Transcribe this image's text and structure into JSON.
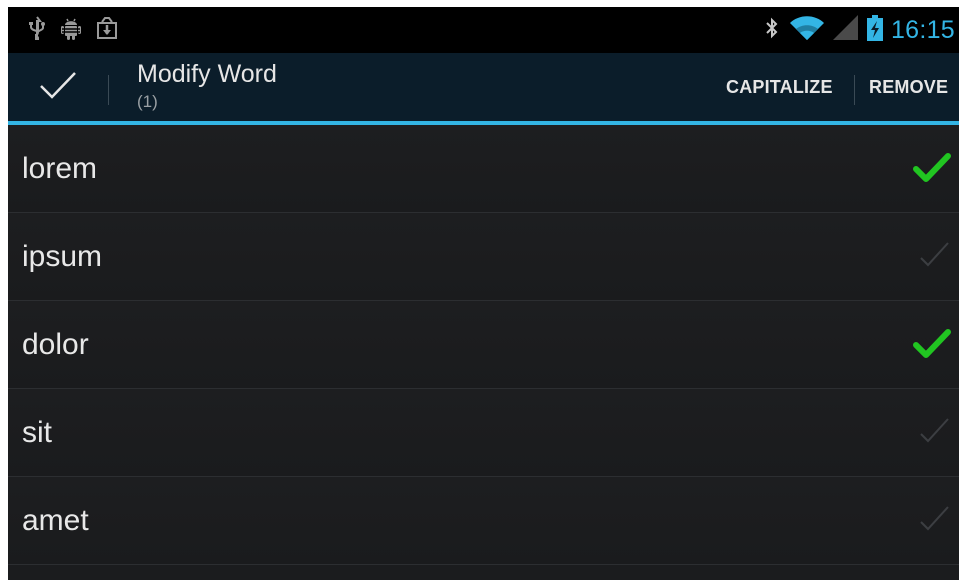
{
  "status_bar": {
    "left_icons": [
      "usb-icon",
      "android-debug-icon",
      "download-icon"
    ],
    "right_icons": [
      "bluetooth-icon",
      "wifi-icon",
      "signal-icon",
      "battery-charging-icon"
    ],
    "time": "16:15"
  },
  "action_bar": {
    "done_icon": "checkmark-icon",
    "title": "Modify Word",
    "subtitle": "(1)",
    "actions": [
      {
        "label": "CAPITALIZE"
      },
      {
        "label": "REMOVE"
      }
    ]
  },
  "words": [
    {
      "text": "lorem",
      "checked": true
    },
    {
      "text": "ipsum",
      "checked": false
    },
    {
      "text": "dolor",
      "checked": true
    },
    {
      "text": "sit",
      "checked": false
    },
    {
      "text": "amet",
      "checked": false
    }
  ],
  "colors": {
    "accent": "#33b5e5",
    "check_on": "#21c521",
    "check_off": "#3c3e42",
    "action_bar_bg": "#0b1d2a"
  }
}
